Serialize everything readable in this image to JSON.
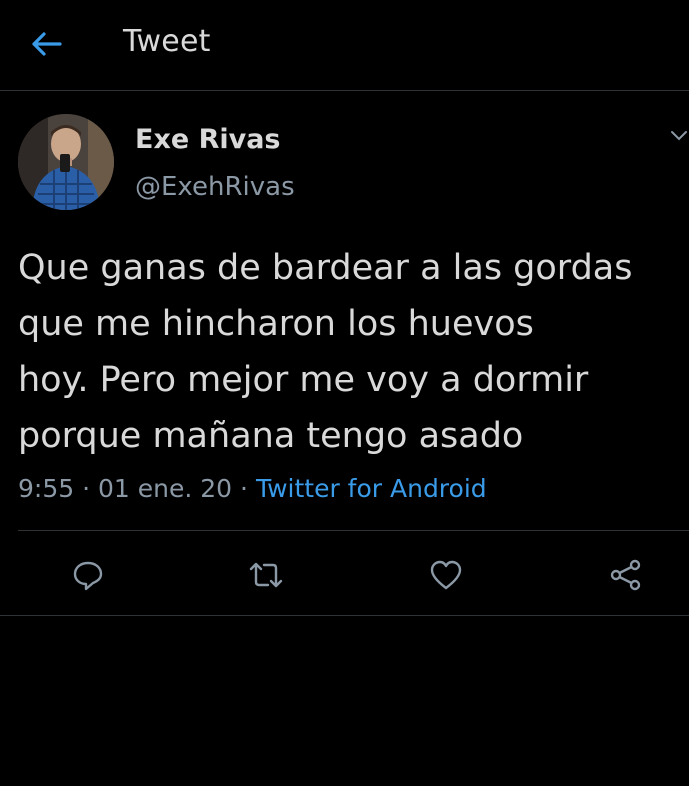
{
  "header": {
    "back_icon": "arrow-left-icon",
    "title": "Tweet",
    "accent_color": "#3a9be8"
  },
  "tweet": {
    "author_name": "Exe Rivas",
    "author_handle": "@ExehRivas",
    "text": "Que ganas de bardear a las gordas\nque me hincharon los huevos\nhoy. Pero mejor me voy a dormir\nporque mañana tengo asado",
    "time": "9:55",
    "date": "01 ene. 20",
    "source": "Twitter for Android",
    "separator": "·"
  },
  "actions": [
    {
      "name": "reply",
      "icon": "speech-bubble-icon"
    },
    {
      "name": "retweet",
      "icon": "retweet-icon"
    },
    {
      "name": "like",
      "icon": "heart-icon"
    },
    {
      "name": "share",
      "icon": "share-icon"
    }
  ],
  "colors": {
    "background": "#000000",
    "text": "#d9d9d9",
    "secondary_text": "#8b98a5",
    "link": "#3a9be8",
    "divider": "#2f3336"
  }
}
